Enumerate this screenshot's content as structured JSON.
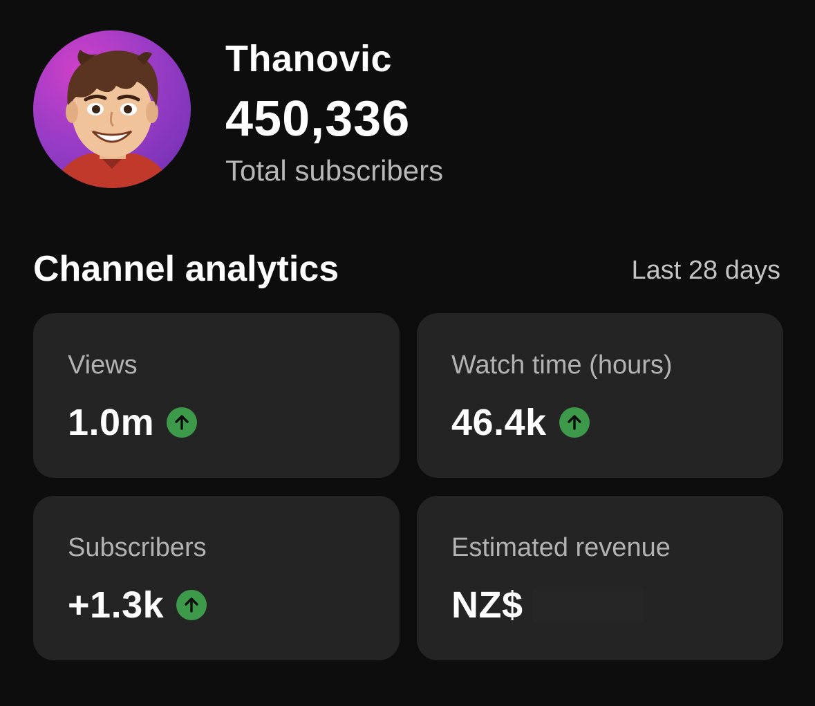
{
  "profile": {
    "channel_name": "Thanovic",
    "subscriber_count": "450,336",
    "subscriber_label": "Total subscribers"
  },
  "analytics": {
    "title": "Channel analytics",
    "period": "Last 28 days",
    "metrics": [
      {
        "label": "Views",
        "value": "1.0m",
        "trend": "up"
      },
      {
        "label": "Watch time (hours)",
        "value": "46.4k",
        "trend": "up"
      },
      {
        "label": "Subscribers",
        "value": "+1.3k",
        "trend": "up"
      },
      {
        "label": "Estimated revenue",
        "value": "NZ$",
        "trend": "hidden"
      }
    ]
  },
  "colors": {
    "background": "#0d0d0d",
    "card": "#242424",
    "trend_up": "#3d9a4a",
    "avatar_gradient": [
      "#d040c8",
      "#6a2fb0"
    ]
  },
  "icons": {
    "trend_up": "arrow-up-circle-icon",
    "avatar": "cartoon-avatar"
  }
}
